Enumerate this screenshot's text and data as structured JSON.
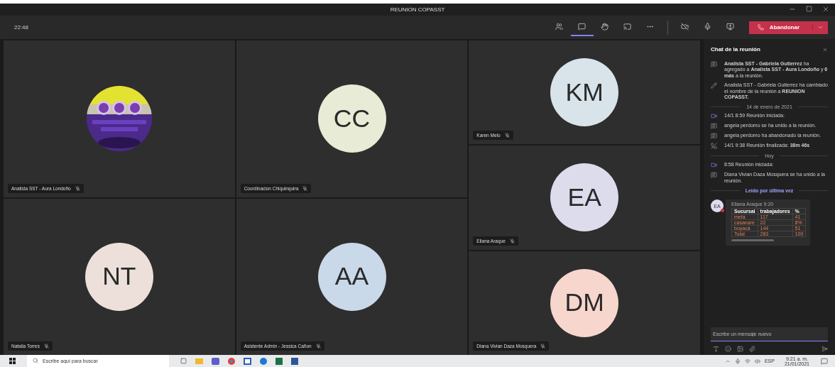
{
  "window": {
    "title": "REUNION COPASST"
  },
  "toolbar": {
    "time": "22:48",
    "buttons": [
      {
        "kind": "people",
        "selected": false
      },
      {
        "kind": "chat",
        "selected": true
      },
      {
        "kind": "hand",
        "selected": false
      },
      {
        "kind": "rooms",
        "selected": false
      },
      {
        "kind": "more",
        "selected": false
      }
    ],
    "controls": [
      {
        "kind": "camera-off"
      },
      {
        "kind": "mic"
      },
      {
        "kind": "share"
      }
    ],
    "leave_label": "Abandonar"
  },
  "grid_columns": [
    [
      {
        "kind": "picture",
        "name": "Analista SST - Aura Londoño"
      },
      {
        "kind": "avatar",
        "initials": "NT",
        "color": "#ede0da",
        "name": "Natalia Torres"
      }
    ],
    [
      {
        "kind": "avatar",
        "initials": "CC",
        "color": "#e8ebd5",
        "name": "Coordinacion Chiquinquira"
      },
      {
        "kind": "avatar",
        "initials": "AA",
        "color": "#c9d9ea",
        "name": "Asistente Admin - Jessica Cañon"
      }
    ],
    [
      {
        "kind": "avatar",
        "initials": "KM",
        "color": "#d8e4ea",
        "name": "Karen Melo"
      },
      {
        "kind": "avatar",
        "initials": "EA",
        "color": "#dcdcec",
        "name": "Eliana Araque"
      },
      {
        "kind": "avatar",
        "initials": "DM",
        "color": "#f6d6cd",
        "name": "Diana Vivian Daza Mosquera"
      }
    ]
  ],
  "chat": {
    "title": "Chat de la reunión",
    "items": [
      {
        "kind": "join",
        "text": "**Analista SST - Gabriela Gutierrez** ha agregado a **Analista SST - Aura Londoño** y **6 más** a la reunión."
      },
      {
        "kind": "rename",
        "text": "Analista SST - Gabriela Gutierrez ha cambiado el nombre de la reunión a **REUNION COPASST.**"
      },
      {
        "kind": "divider",
        "label": "14 de enero de 2021"
      },
      {
        "kind": "start",
        "text": "14/1 8:59   Reunión iniciada:"
      },
      {
        "kind": "join",
        "text": "angela perdomo se ha unido a la reunión."
      },
      {
        "kind": "join",
        "text": "angela perdomo ha abandonado la reunión."
      },
      {
        "kind": "end",
        "text": "14/1 9:38   Reunión finalizada: **38m 46s**"
      },
      {
        "kind": "divider",
        "label": "Hoy"
      },
      {
        "kind": "start",
        "text": "8:58   Reunión iniciada:"
      },
      {
        "kind": "join",
        "text": "Diana Vivian Daza Mosquera se ha unido a la reunión."
      },
      {
        "kind": "read-marker",
        "label": "Leído por última vez"
      }
    ],
    "message": {
      "initials": "EA",
      "author": "Eliana Araque",
      "time": "9:20",
      "columns": [
        "Sucursal",
        "trabajadores",
        "%"
      ],
      "rows": [
        [
          "meta",
          "117",
          "41"
        ],
        [
          "casanare",
          "22",
          "8%"
        ],
        [
          "boyacá",
          "144",
          "51"
        ],
        [
          "Total",
          "283",
          "100"
        ]
      ]
    },
    "compose": {
      "placeholder": "Escribe un mensaje nuevo"
    }
  },
  "taskbar": {
    "search": {
      "placeholder": "Escribe aquí para buscar"
    },
    "language": "ESP",
    "time": "9:21 a. m.",
    "date": "21/01/2021"
  }
}
